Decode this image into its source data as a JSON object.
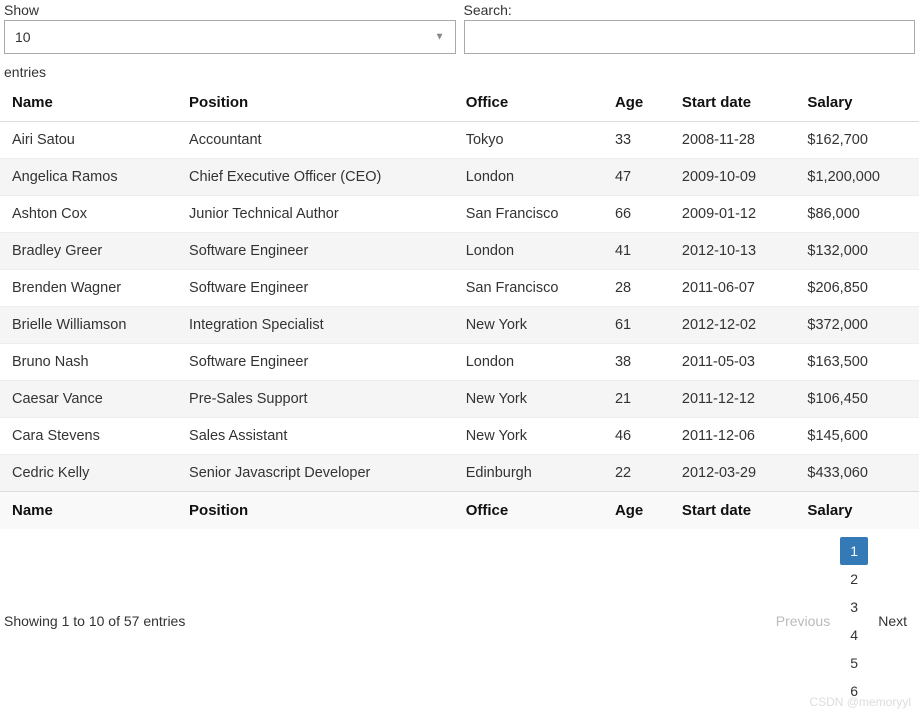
{
  "controls": {
    "show_label": "Show",
    "page_size": "10",
    "entries_label": "entries",
    "search_label": "Search:",
    "search_value": ""
  },
  "columns": {
    "name": "Name",
    "position": "Position",
    "office": "Office",
    "age": "Age",
    "start_date": "Start date",
    "salary": "Salary"
  },
  "rows": [
    {
      "name": "Airi Satou",
      "position": "Accountant",
      "office": "Tokyo",
      "age": "33",
      "start_date": "2008-11-28",
      "salary": "$162,700"
    },
    {
      "name": "Angelica Ramos",
      "position": "Chief Executive Officer (CEO)",
      "office": "London",
      "age": "47",
      "start_date": "2009-10-09",
      "salary": "$1,200,000"
    },
    {
      "name": "Ashton Cox",
      "position": "Junior Technical Author",
      "office": "San Francisco",
      "age": "66",
      "start_date": "2009-01-12",
      "salary": "$86,000"
    },
    {
      "name": "Bradley Greer",
      "position": "Software Engineer",
      "office": "London",
      "age": "41",
      "start_date": "2012-10-13",
      "salary": "$132,000"
    },
    {
      "name": "Brenden Wagner",
      "position": "Software Engineer",
      "office": "San Francisco",
      "age": "28",
      "start_date": "2011-06-07",
      "salary": "$206,850"
    },
    {
      "name": "Brielle Williamson",
      "position": "Integration Specialist",
      "office": "New York",
      "age": "61",
      "start_date": "2012-12-02",
      "salary": "$372,000"
    },
    {
      "name": "Bruno Nash",
      "position": "Software Engineer",
      "office": "London",
      "age": "38",
      "start_date": "2011-05-03",
      "salary": "$163,500"
    },
    {
      "name": "Caesar Vance",
      "position": "Pre-Sales Support",
      "office": "New York",
      "age": "21",
      "start_date": "2011-12-12",
      "salary": "$106,450"
    },
    {
      "name": "Cara Stevens",
      "position": "Sales Assistant",
      "office": "New York",
      "age": "46",
      "start_date": "2011-12-06",
      "salary": "$145,600"
    },
    {
      "name": "Cedric Kelly",
      "position": "Senior Javascript Developer",
      "office": "Edinburgh",
      "age": "22",
      "start_date": "2012-03-29",
      "salary": "$433,060"
    }
  ],
  "footer": {
    "info": "Showing 1 to 10 of 57 entries",
    "prev": "Previous",
    "next": "Next",
    "pages": [
      "1",
      "2",
      "3",
      "4",
      "5",
      "6"
    ],
    "current_page": "1"
  },
  "watermark": "CSDN @memoryyl"
}
